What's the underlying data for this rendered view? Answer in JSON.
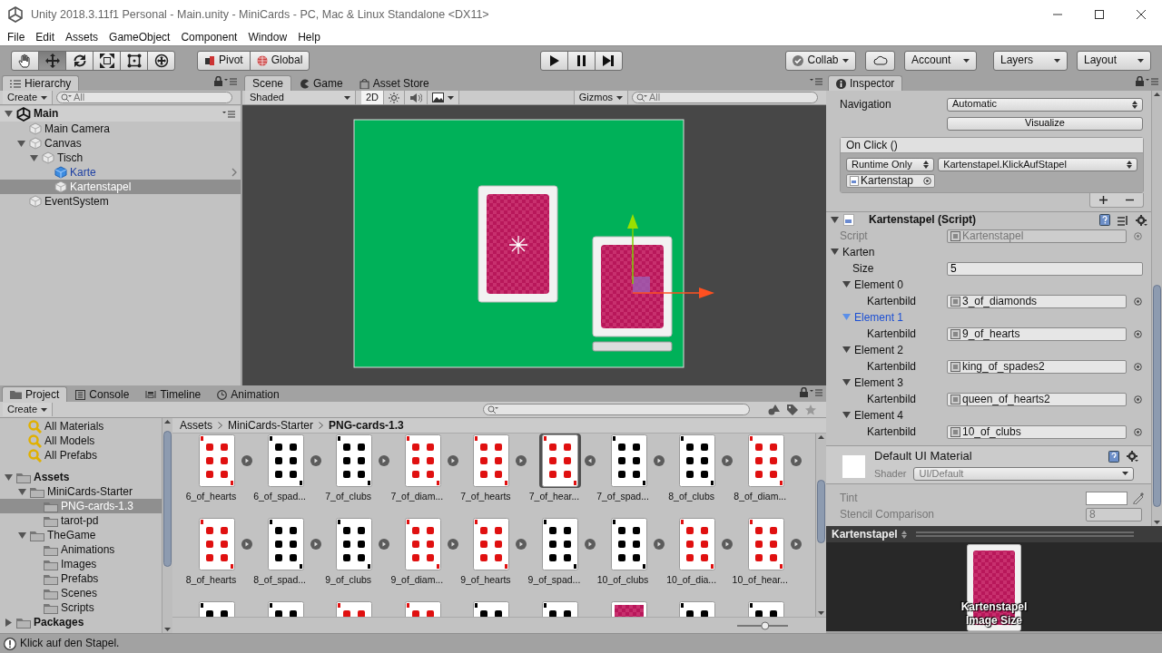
{
  "window": {
    "title": "Unity 2018.3.11f1 Personal - Main.unity - MiniCards - PC, Mac & Linux Standalone <DX11>"
  },
  "menu": [
    "File",
    "Edit",
    "Assets",
    "GameObject",
    "Component",
    "Window",
    "Help"
  ],
  "toolbar": {
    "tools": [
      {
        "kind": "hand",
        "selected": false
      },
      {
        "kind": "move",
        "selected": true
      },
      {
        "kind": "rotate",
        "selected": false
      },
      {
        "kind": "scale",
        "selected": false
      },
      {
        "kind": "rect",
        "selected": false
      },
      {
        "kind": "transform",
        "selected": false
      }
    ],
    "pivot": "Pivot",
    "global": "Global",
    "playback": [
      {
        "kind": "play",
        "selected": false
      },
      {
        "kind": "pause",
        "selected": false
      },
      {
        "kind": "step",
        "selected": false
      }
    ],
    "collab": "Collab",
    "account": "Account",
    "layers": "Layers",
    "layout": "Layout"
  },
  "hierarchy": {
    "tab": "Hierarchy",
    "create": "Create",
    "search_placeholder": "All",
    "items": [
      {
        "label": "Main",
        "kind": "scene",
        "expanded": true,
        "selected": false,
        "children": [
          {
            "label": "Main Camera",
            "kind": "object",
            "selected": false
          },
          {
            "label": "Canvas",
            "kind": "object",
            "expanded": true,
            "selected": false,
            "children": [
              {
                "label": "Tisch",
                "kind": "object",
                "expanded": true,
                "selected": false,
                "children": [
                  {
                    "label": "Karte",
                    "kind": "prefab",
                    "selected": false
                  },
                  {
                    "label": "Kartenstapel",
                    "kind": "object",
                    "selected": true
                  }
                ]
              }
            ]
          },
          {
            "label": "EventSystem",
            "kind": "object",
            "selected": false
          }
        ]
      }
    ]
  },
  "scene_view": {
    "tabs": [
      {
        "label": "Scene",
        "kind": "scene",
        "selected": true
      },
      {
        "label": "Game",
        "kind": "game",
        "selected": false
      },
      {
        "label": "Asset Store",
        "kind": "store",
        "selected": false
      }
    ],
    "shading": "Shaded",
    "toggle_2d": {
      "label": "2D",
      "on": true
    },
    "lighting": {
      "on": false
    },
    "audio": {
      "on": false
    },
    "gizmos": "Gizmos",
    "search_placeholder": "All"
  },
  "project": {
    "tabs": [
      {
        "label": "Project",
        "kind": "project",
        "selected": true
      },
      {
        "label": "Console",
        "kind": "console",
        "selected": false
      },
      {
        "label": "Timeline",
        "kind": "timeline",
        "selected": false
      },
      {
        "label": "Animation",
        "kind": "animation",
        "selected": false
      }
    ],
    "create": "Create",
    "favorites": [
      "All Materials",
      "All Models",
      "All Prefabs"
    ],
    "tree": [
      {
        "label": "Assets",
        "expanded": true,
        "selected": false,
        "children": [
          {
            "label": "MiniCards-Starter",
            "expanded": true,
            "selected": false,
            "children": [
              {
                "label": "PNG-cards-1.3",
                "selected": true
              },
              {
                "label": "tarot-pd",
                "selected": false
              }
            ]
          },
          {
            "label": "TheGame",
            "expanded": true,
            "selected": false,
            "children": [
              {
                "label": "Animations",
                "selected": false
              },
              {
                "label": "Images",
                "selected": false
              },
              {
                "label": "Prefabs",
                "selected": false
              },
              {
                "label": "Scenes",
                "selected": false
              },
              {
                "label": "Scripts",
                "selected": false
              }
            ]
          }
        ]
      },
      {
        "label": "Packages",
        "expanded": false,
        "selected": false
      }
    ],
    "breadcrumb": [
      "Assets",
      "MiniCards-Starter",
      "PNG-cards-1.3"
    ],
    "thumbnail_size": {
      "level": 0.55
    },
    "assets": [
      {
        "label": "6_of_hearts",
        "kind": "card",
        "color": "#e01010",
        "expandable": true,
        "selected": false
      },
      {
        "label": "6_of_spad...",
        "kind": "card",
        "color": "#000000",
        "expandable": true,
        "selected": false
      },
      {
        "label": "7_of_clubs",
        "kind": "card",
        "color": "#000000",
        "expandable": true,
        "selected": false
      },
      {
        "label": "7_of_diam...",
        "kind": "card",
        "color": "#e01010",
        "expandable": true,
        "selected": false
      },
      {
        "label": "7_of_hearts",
        "kind": "card",
        "color": "#e01010",
        "expandable": true,
        "selected": false
      },
      {
        "label": "7_of_hear...",
        "kind": "card",
        "color": "#e01010",
        "expandable": true,
        "selected": true
      },
      {
        "label": "7_of_spad...",
        "kind": "card",
        "color": "#000000",
        "expandable": true,
        "selected": false
      },
      {
        "label": "8_of_clubs",
        "kind": "card",
        "color": "#000000",
        "expandable": true,
        "selected": false
      },
      {
        "label": "8_of_diam...",
        "kind": "card",
        "color": "#e01010",
        "expandable": true,
        "selected": false
      },
      {
        "label": "8_of_hearts",
        "kind": "card",
        "color": "#e01010",
        "expandable": true,
        "selected": false
      },
      {
        "label": "8_of_spad...",
        "kind": "card",
        "color": "#000000",
        "expandable": true,
        "selected": false
      },
      {
        "label": "9_of_clubs",
        "kind": "card",
        "color": "#000000",
        "expandable": true,
        "selected": false
      },
      {
        "label": "9_of_diam...",
        "kind": "card",
        "color": "#e01010",
        "expandable": true,
        "selected": false
      },
      {
        "label": "9_of_hearts",
        "kind": "card",
        "color": "#e01010",
        "expandable": true,
        "selected": false
      },
      {
        "label": "9_of_spad...",
        "kind": "card",
        "color": "#000000",
        "expandable": true,
        "selected": false
      },
      {
        "label": "10_of_clubs",
        "kind": "card",
        "color": "#000000",
        "expandable": true,
        "selected": false
      },
      {
        "label": "10_of_dia...",
        "kind": "card",
        "color": "#e01010",
        "expandable": true,
        "selected": false
      },
      {
        "label": "10_of_hear...",
        "kind": "card",
        "color": "#e01010",
        "expandable": true,
        "selected": false
      },
      {
        "kind": "card",
        "color": "#000000",
        "selected": false
      },
      {
        "kind": "card",
        "color": "#000000",
        "selected": false
      },
      {
        "kind": "card",
        "color": "#e01010",
        "selected": false
      },
      {
        "kind": "card",
        "color": "#e01010",
        "selected": false
      },
      {
        "kind": "card",
        "color": "#000000",
        "selected": false
      },
      {
        "kind": "card",
        "color": "#000000",
        "selected": false
      },
      {
        "kind": "back",
        "selected": false
      },
      {
        "kind": "card",
        "color": "#000000",
        "selected": false
      },
      {
        "kind": "card",
        "color": "#000000",
        "selected": false
      }
    ]
  },
  "inspector": {
    "tab": "Inspector",
    "navigation_label": "Navigation",
    "navigation_value": "Automatic",
    "visualize": "Visualize",
    "on_click": {
      "title": "On Click ()",
      "mode": "Runtime Only",
      "function": "Kartenstapel.KlickAufStapel",
      "target": "Kartenstap"
    },
    "script_component": {
      "title": "Kartenstapel (Script)",
      "script_label": "Script",
      "script_value": "Kartenstapel",
      "array_label": "Karten",
      "size_label": "Size",
      "size_value": "5",
      "elements": [
        {
          "label": "Element 0",
          "selected": false,
          "field_label": "Kartenbild",
          "value": "3_of_diamonds"
        },
        {
          "label": "Element 1",
          "selected": true,
          "field_label": "Kartenbild",
          "value": "9_of_hearts"
        },
        {
          "label": "Element 2",
          "selected": false,
          "field_label": "Kartenbild",
          "value": "king_of_spades2"
        },
        {
          "label": "Element 3",
          "selected": false,
          "field_label": "Kartenbild",
          "value": "queen_of_hearts2"
        },
        {
          "label": "Element 4",
          "selected": false,
          "field_label": "Kartenbild",
          "value": "10_of_clubs"
        }
      ]
    },
    "material": {
      "title": "Default UI Material",
      "shader_label": "Shader",
      "shader_value": "UI/Default",
      "tint_label": "Tint",
      "stencil_label": "Stencil Comparison",
      "stencil_value": "8"
    }
  },
  "preview": {
    "title": "Kartenstapel",
    "caption": "Kartenstapel",
    "detail": "Image Size"
  },
  "status_bar": "Klick auf den Stapel."
}
